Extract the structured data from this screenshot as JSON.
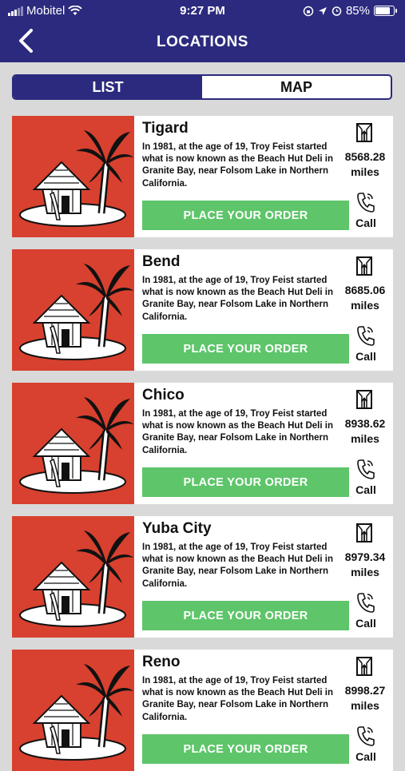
{
  "status_bar": {
    "carrier": "Mobitel",
    "time": "9:27 PM",
    "battery": "85%"
  },
  "header": {
    "title": "LOCATIONS",
    "back_icon": "chevron-left-icon"
  },
  "segmented": {
    "list_label": "LIST",
    "map_label": "MAP",
    "selected": "LIST"
  },
  "colors": {
    "header": "#2b2a7e",
    "order_button": "#5ec56a",
    "thumbnail_bg": "#d8412f"
  },
  "locations": [
    {
      "name": "Tigard",
      "description": "In 1981, at the age of 19, Troy Feist started what is now known as the Beach Hut Deli in Granite Bay, near Folsom Lake in Northern California.",
      "order_label": "PLACE YOUR ORDER",
      "distance_value": "8568.28",
      "distance_unit": "miles",
      "call_label": "Call"
    },
    {
      "name": "Bend",
      "description": "In 1981, at the age of 19, Troy Feist started what is now known as the Beach Hut Deli in Granite Bay, near Folsom Lake in Northern California.",
      "order_label": "PLACE YOUR ORDER",
      "distance_value": "8685.06",
      "distance_unit": "miles",
      "call_label": "Call"
    },
    {
      "name": "Chico",
      "description": "In 1981, at the age of 19, Troy Feist started what is now known as the Beach Hut Deli in Granite Bay, near Folsom Lake in Northern California.",
      "order_label": "PLACE YOUR ORDER",
      "distance_value": "8938.62",
      "distance_unit": "miles",
      "call_label": "Call"
    },
    {
      "name": "Yuba City",
      "description": "In 1981, at the age of 19, Troy Feist started what is now known as the Beach Hut Deli in Granite Bay, near Folsom Lake in Northern California.",
      "order_label": "PLACE YOUR ORDER",
      "distance_value": "8979.34",
      "distance_unit": "miles",
      "call_label": "Call"
    },
    {
      "name": "Reno",
      "description": "In 1981, at the age of 19, Troy Feist started what is now known as the Beach Hut Deli in Granite Bay, near Folsom Lake in Northern California.",
      "order_label": "PLACE YOUR ORDER",
      "distance_value": "8998.27",
      "distance_unit": "miles",
      "call_label": "Call"
    }
  ]
}
